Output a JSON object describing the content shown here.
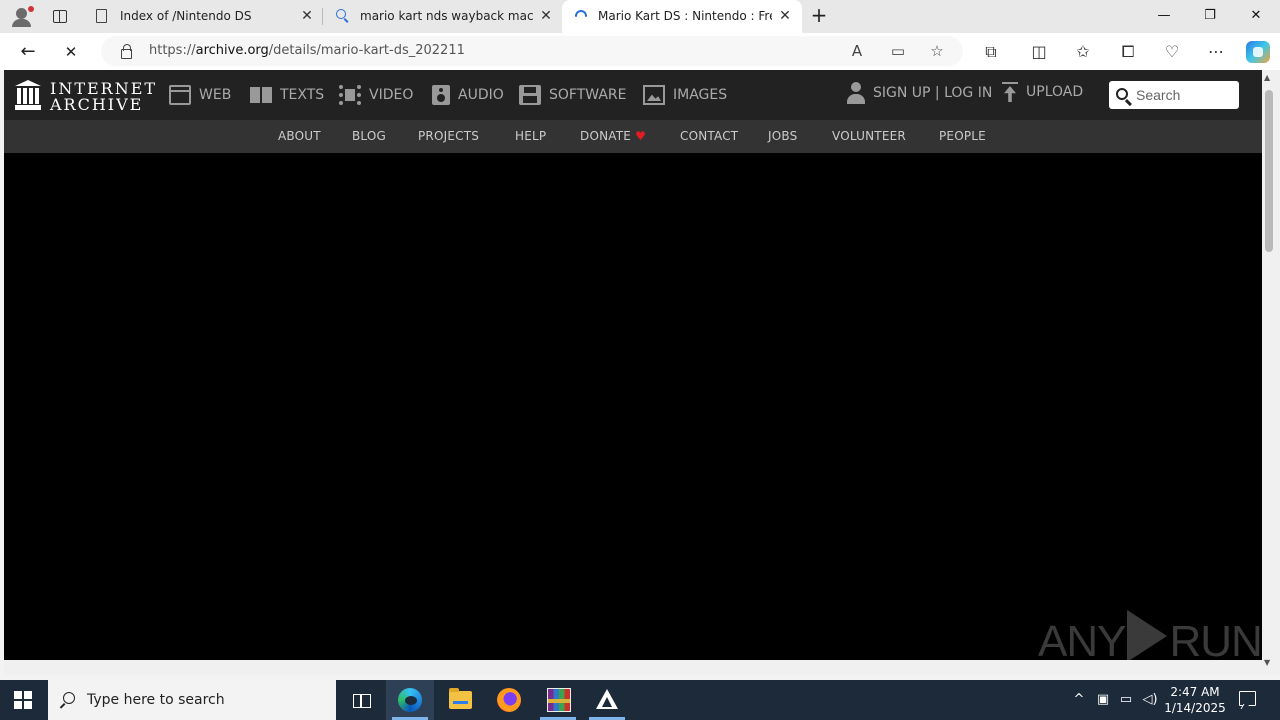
{
  "browser": {
    "tabs": [
      {
        "title": "Index of /Nintendo DS",
        "icon": "document-icon"
      },
      {
        "title": "mario kart nds wayback machine",
        "icon": "search-icon"
      },
      {
        "title": "Mario Kart DS : Nintendo : Free D",
        "icon": "loading-spinner-icon",
        "active": true
      }
    ],
    "new_tab": "+",
    "window_controls": {
      "minimize": "—",
      "restore": "❐",
      "close": "✕"
    },
    "url": {
      "prefix": "https://",
      "domain": "archive.org",
      "path": "/details/mario-kart-ds_202211"
    },
    "nav": {
      "back": "←",
      "stop": "✕"
    }
  },
  "ia": {
    "logo": {
      "line1": "INTERNET",
      "line2": "ARCHIVE"
    },
    "nav": [
      {
        "label": "WEB",
        "icon": "web-icon"
      },
      {
        "label": "TEXTS",
        "icon": "book-icon"
      },
      {
        "label": "VIDEO",
        "icon": "film-icon"
      },
      {
        "label": "AUDIO",
        "icon": "speaker-icon"
      },
      {
        "label": "SOFTWARE",
        "icon": "floppy-disk-icon"
      },
      {
        "label": "IMAGES",
        "icon": "image-icon"
      }
    ],
    "signin": "SIGN UP | LOG IN",
    "upload": "UPLOAD",
    "search_placeholder": "Search",
    "subnav": [
      "ABOUT",
      "BLOG",
      "PROJECTS",
      "HELP",
      "DONATE",
      "CONTACT",
      "JOBS",
      "VOLUNTEER",
      "PEOPLE"
    ],
    "donate_heart": "♥"
  },
  "watermark": {
    "left": "ANY",
    "right": "RUN"
  },
  "taskbar": {
    "search_placeholder": "Type here to search",
    "time": "2:47 AM",
    "date": "1/14/2025"
  },
  "colors": {
    "ia_header": "#222222",
    "ia_subnav": "#333333",
    "donate_heart": "#e51b23",
    "taskbar": "#1c2a3a"
  }
}
